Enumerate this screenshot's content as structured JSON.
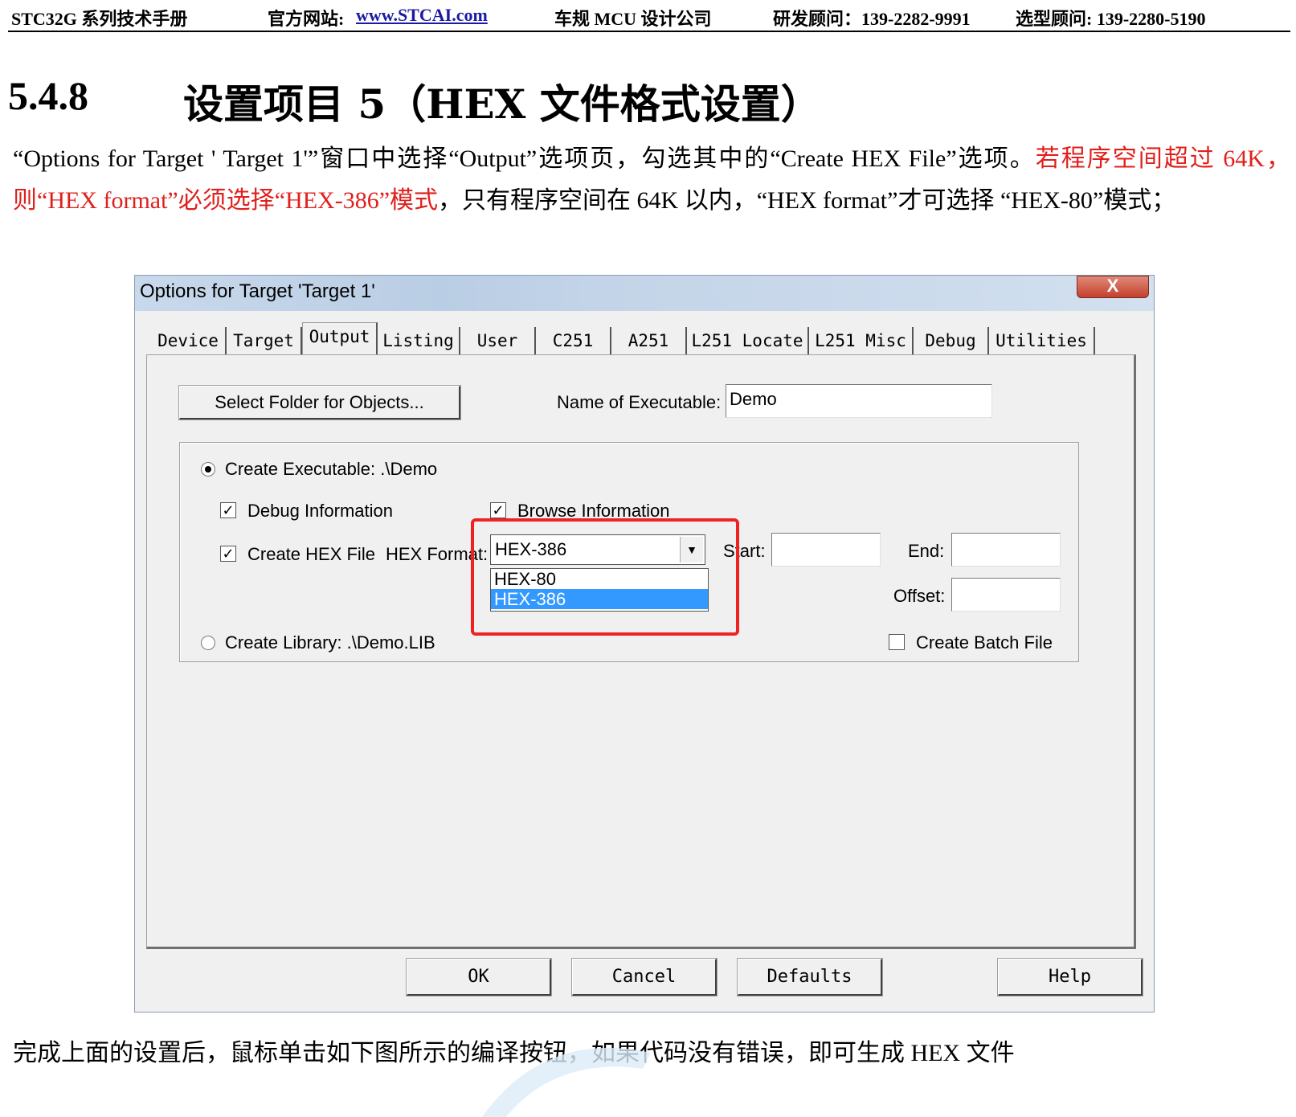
{
  "header": {
    "manual": "STC32G 系列技术手册",
    "site_label": "官方网站: ",
    "site_link": "www.STCAI.com",
    "company": "车规 MCU 设计公司",
    "rd_contact": "研发顾问：139-2282-9991",
    "sel_contact": "选型顾问: 139-2280-5190"
  },
  "section": {
    "number": "5.4.8",
    "title": "设置项目 5（HEX 文件格式设置）"
  },
  "paragraph": {
    "part1": "“Options for Target ' Target 1'”窗口中选择“Output”选项页，勾选其中的“Create HEX File”选项。",
    "part2_red": "若程序空间超过 64K，则“HEX format”必须选择“HEX-386”模式",
    "part3": "，只有程序空间在 64K 以内，“HEX format”才可选择 “HEX-80”模式；"
  },
  "dialog": {
    "title": "Options for Target 'Target 1'",
    "close": "X",
    "tabs": [
      "Device",
      "Target",
      "Output",
      "Listing",
      "User",
      "C251",
      "A251",
      "L251 Locate",
      "L251 Misc",
      "Debug",
      "Utilities"
    ],
    "select_folder_btn": "Select Folder for Objects...",
    "name_label": "Name of Executable:",
    "name_value": "Demo",
    "create_exec": "Create Executable:  .\\Demo",
    "debug_info": "Debug Information",
    "browse_info": "Browse Information",
    "create_hex": "Create HEX File",
    "hex_format_label": "HEX Format:",
    "hex_selected": "HEX-386",
    "hex_options": [
      "HEX-80",
      "HEX-386"
    ],
    "start_label": "Start:",
    "end_label": "End:",
    "offset_label": "Offset:",
    "create_library": "Create Library:  .\\Demo.LIB",
    "create_batch": "Create Batch File",
    "buttons": {
      "ok": "OK",
      "cancel": "Cancel",
      "defaults": "Defaults",
      "help": "Help"
    }
  },
  "bottom_text": "完成上面的设置后，鼠标单击如下图所示的编译按钮，如果代码没有错误，即可生成 HEX 文件"
}
